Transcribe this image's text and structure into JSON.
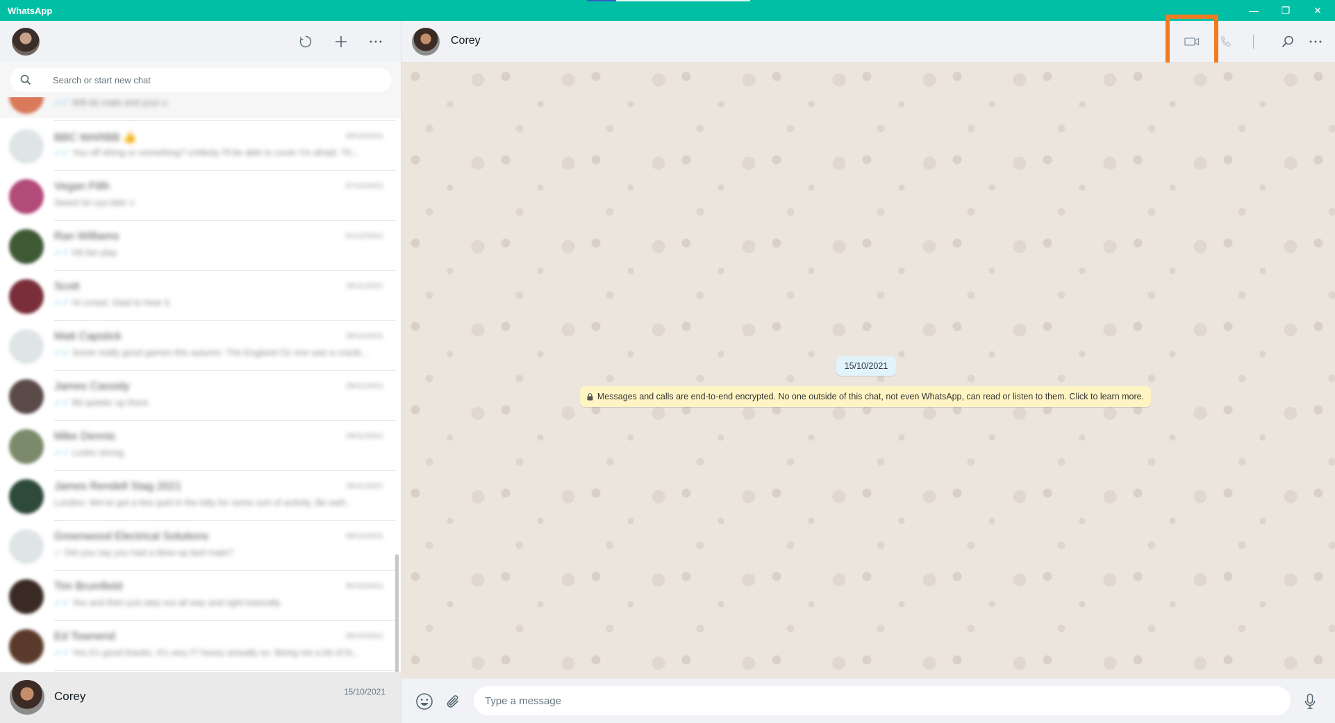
{
  "window": {
    "title": "WhatsApp",
    "controls": {
      "minimize": "—",
      "maximize": "❐",
      "close": "✕"
    }
  },
  "sidebar": {
    "header": {
      "icons": [
        "status-icon",
        "new-chat-icon",
        "menu-icon"
      ]
    },
    "search": {
      "placeholder": "Search or start new chat"
    },
    "chats": [
      {
        "name": "",
        "time": "",
        "preview": "Will do mate and your u",
        "avatar_color": "#d97a5a"
      },
      {
        "name": "BBC MARBB 👍",
        "time": "18/12/2021",
        "preview": "You off skiing or something? Unlikely I'll be able to cover I'm afraid. Th...",
        "avatar_color": "#dfe5e7"
      },
      {
        "name": "Vegan Filth",
        "time": "07/12/2021",
        "preview": "Sweet lol cya later x",
        "avatar_color": "#b24a7a"
      },
      {
        "name": "Ran Williams",
        "time": "01/12/2021",
        "preview": "Hit fan play",
        "avatar_color": "#3e5a35"
      },
      {
        "name": "Scott",
        "time": "28/11/2021",
        "preview": "Hi crowd. Glad to hear it.",
        "avatar_color": "#7a2e3a"
      },
      {
        "name": "Matt Capstick",
        "time": "28/11/2021",
        "preview": "Some really good games this autumn. The England Oz one was a cracki...",
        "avatar_color": "#dfe5e7"
      },
      {
        "name": "James Cassidy",
        "time": "28/11/2021",
        "preview": "Bit quieter up there",
        "avatar_color": "#5a4a48"
      },
      {
        "name": "Mike Dennis",
        "time": "28/11/2021",
        "preview": "Looks strong",
        "avatar_color": "#7a8a6a"
      },
      {
        "name": "James Rendell Stag 2021",
        "time": "28/11/2021",
        "preview": "London: We've got a few quid in the kitty for some sort of activity. Be well...",
        "avatar_color": "#2e4a3a"
      },
      {
        "name": "Greenwood Electrical Solutions",
        "time": "08/11/2021",
        "preview": "Did you say you had a blow-up bed mate?",
        "avatar_color": "#dfe5e7"
      },
      {
        "name": "Tim Brumfield",
        "time": "30/10/2021",
        "preview": "Yes and then just step out all way and right basically",
        "avatar_color": "#3a2a24"
      },
      {
        "name": "Ed Townend",
        "time": "28/10/2021",
        "preview": "Yes it's good thanks. It's very IT heavy actually so. Being me a bit of fo...",
        "avatar_color": "#5a3a2a"
      }
    ],
    "active_chat": {
      "name": "Corey",
      "time": "15/10/2021"
    }
  },
  "conversation": {
    "contact_name": "Corey",
    "header_icons": [
      "video-call-icon",
      "voice-call-icon",
      "search-icon",
      "menu-icon"
    ],
    "date_label": "15/10/2021",
    "encryption_notice": "Messages and calls are end-to-end encrypted. No one outside of this chat, not even WhatsApp, can read or listen to them. Click to learn more.",
    "compose": {
      "placeholder": "Type a message"
    }
  },
  "colors": {
    "titlebar": "#00bfa5",
    "highlight": "#f07b21",
    "chat_bg": "#ece5dd",
    "encryption_bg": "#fff5c4",
    "date_bg": "#e1f3fb"
  }
}
